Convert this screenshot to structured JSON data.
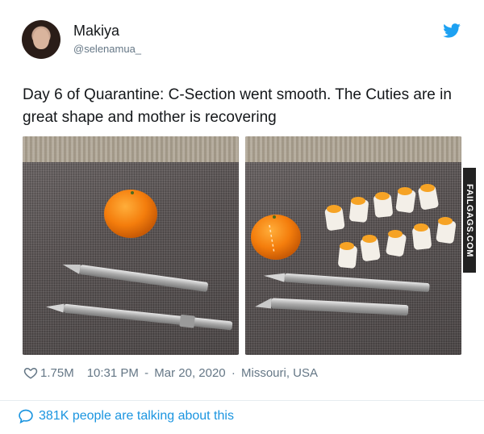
{
  "tweet": {
    "author_name": "Makiya",
    "author_handle": "@selenamua_",
    "text": "Day 6 of Quarantine: C-Section went smooth. The Cuties are in great shape and mother is recovering",
    "likes": "1.75M",
    "time": "10:31 PM",
    "date": "Mar 20, 2020",
    "location": "Missouri, USA",
    "conversation": "381K people are talking about this"
  },
  "watermark": "FAILGAGS.COM",
  "colors": {
    "twitter_blue": "#1da1f2",
    "link_blue": "#1b95e0",
    "secondary_text": "#657786"
  },
  "icons": {
    "brand": "twitter-bird-icon",
    "like": "heart-icon",
    "reply": "speech-bubble-icon"
  }
}
